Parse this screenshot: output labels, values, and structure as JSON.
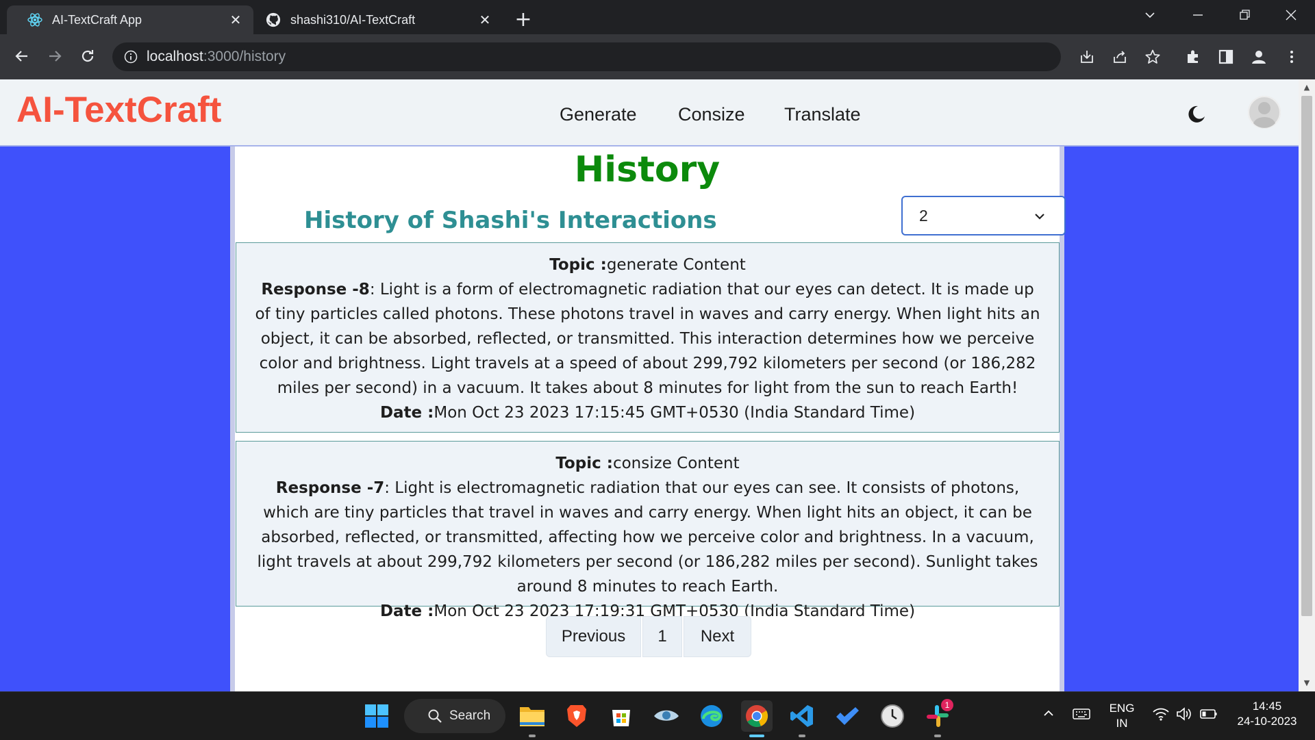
{
  "browser": {
    "tabs": [
      {
        "title": "AI-TextCraft App",
        "icon": "react-icon",
        "active": true
      },
      {
        "title": "shashi310/AI-TextCraft",
        "icon": "github-icon",
        "active": false
      }
    ],
    "url_host": "localhost",
    "url_path": ":3000/history"
  },
  "app": {
    "brand": "AI-TextCraft",
    "nav": {
      "generate": "Generate",
      "consize": "Consize",
      "translate": "Translate"
    },
    "page_title": "History",
    "subtitle": "History of Shashi's Interactions",
    "select_value": "2"
  },
  "entries": [
    {
      "topic_label": "Topic :",
      "topic": "generate Content",
      "response_label": "Response -8",
      "response": ": Light is a form of electromagnetic radiation that our eyes can detect. It is made up of tiny particles called photons. These photons travel in waves and carry energy. When light hits an object, it can be absorbed, reflected, or transmitted. This interaction determines how we perceive color and brightness. Light travels at a speed of about 299,792 kilometers per second (or 186,282 miles per second) in a vacuum. It takes about 8 minutes for light from the sun to reach Earth!",
      "date_label": "Date :",
      "date": "Mon Oct 23 2023 17:15:45 GMT+0530 (India Standard Time)"
    },
    {
      "topic_label": "Topic :",
      "topic": "consize Content",
      "response_label": "Response -7",
      "response": ": Light is electromagnetic radiation that our eyes can see. It consists of photons, which are tiny particles that travel in waves and carry energy. When light hits an object, it can be absorbed, reflected, or transmitted, affecting how we perceive color and brightness. In a vacuum, light travels at about 299,792 kilometers per second (or 186,282 miles per second). Sunlight takes around 8 minutes to reach Earth.",
      "date_label": "Date :",
      "date": "Mon Oct 23 2023 17:19:31 GMT+0530 (India Standard Time)"
    }
  ],
  "pagination": {
    "previous": "Previous",
    "page": "1",
    "next": "Next"
  },
  "taskbar": {
    "search_label": "Search",
    "lang_top": "ENG",
    "lang_bottom": "IN",
    "time": "14:45",
    "date": "24-10-2023",
    "slack_badge": "1"
  },
  "colors": {
    "page_bg": "#3f51fb",
    "brand": "#f5533e",
    "history_title": "#0c8a0c",
    "subtitle": "#2e8f93"
  }
}
